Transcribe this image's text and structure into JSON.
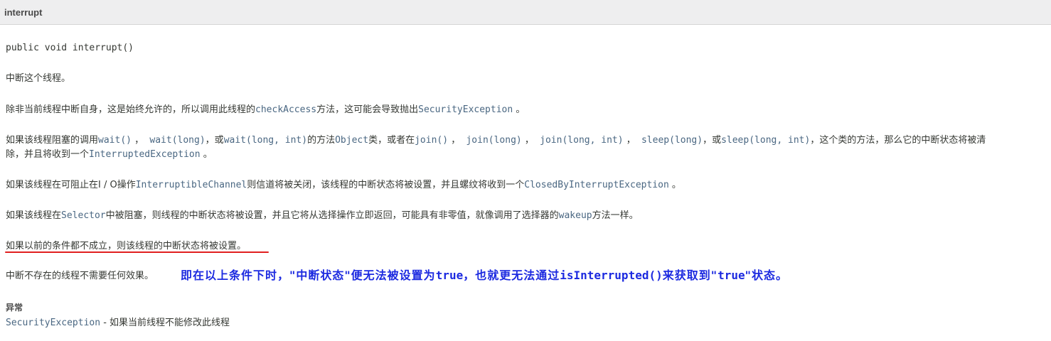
{
  "header": {
    "title": "interrupt"
  },
  "signature": "public void interrupt()",
  "p1": "中断这个线程。",
  "p2": {
    "t1": "除非当前线程中断自身，这是始终允许的，所以调用此线程的",
    "c1": "checkAccess",
    "t2": "方法，这可能会导致抛出",
    "c2": "SecurityException",
    "t3": " 。"
  },
  "p3": {
    "t1": "如果该线程阻塞的调用",
    "c1": "wait()",
    "t2": " ，  ",
    "c2": "wait(long)",
    "t3": "，或",
    "c3": "wait(long, int)",
    "t4": "的方法",
    "c4": "Object",
    "t5": "类，或者在",
    "c5": "join()",
    "t6": " ，  ",
    "c6": "join(long)",
    "t7": " ，  ",
    "c7": "join(long, int)",
    "t8": " ，  ",
    "c8": "sleep(long)",
    "t9": "，或",
    "c9": "sleep(long, int)",
    "t10": "，这个类的方法，那么它的中断状态将被清",
    "t11": "除，并且将收到一个",
    "c10": "InterruptedException",
    "t12": " 。"
  },
  "p4": {
    "t1": "如果该线程在可阻止在I / O操作",
    "c1": "InterruptibleChannel",
    "t2": "则信道将被关闭，该线程的中断状态将被设置，并且螺纹将收到一个",
    "c2": "ClosedByInterruptException",
    "t3": " 。"
  },
  "p5": {
    "t1": "如果该线程在",
    "c1": "Selector",
    "t2": "中被阻塞，则线程的中断状态将被设置，并且它将从选择操作立即返回，可能具有非零值，就像调用了选择器的",
    "c2": "wakeup",
    "t3": "方法一样。"
  },
  "p6": "如果以前的条件都不成立，则该线程的中断状态将被设置。",
  "p7": "中断不存在的线程不需要任何效果。",
  "annotation": {
    "t1": "即在以上条件下时，\"中断状态\"便无法被设置为",
    "c1": "true",
    "t2": "，也就更无法通过",
    "c2": "isInterrupted()",
    "t3": "来获取到\"",
    "c3": "true",
    "t4": "\"状态。"
  },
  "throws": {
    "label": "异常",
    "exception": "SecurityException",
    "description": " - 如果当前线程不能修改此线程"
  },
  "colors": {
    "link": "#4a6782",
    "annotation": "#1c2ae0",
    "underline": "#e02020",
    "header_bg": "#eeeeef"
  }
}
